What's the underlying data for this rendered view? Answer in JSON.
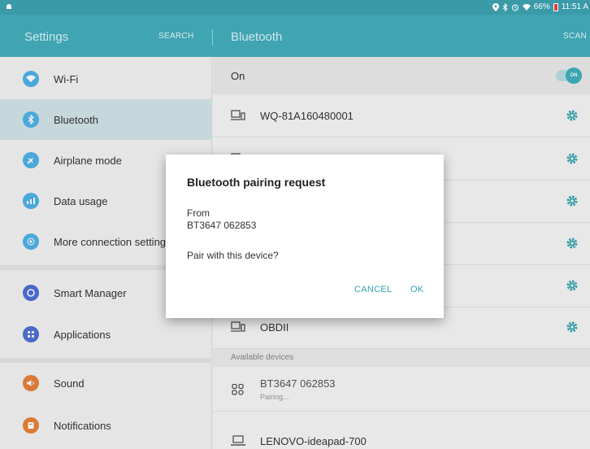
{
  "status_bar": {
    "battery": "66%",
    "time": "11:51 A"
  },
  "app_bar": {
    "left_title": "Settings",
    "search_label": "SEARCH",
    "right_title": "Bluetooth",
    "scan_label": "SCAN"
  },
  "sidebar": {
    "items": [
      {
        "label": "Wi-Fi",
        "icon": "wifi-icon",
        "color": "#4fb3e8"
      },
      {
        "label": "Bluetooth",
        "icon": "bluetooth-icon",
        "color": "#4fb3e8"
      },
      {
        "label": "Airplane mode",
        "icon": "airplane-icon",
        "color": "#4fb3e8"
      },
      {
        "label": "Data usage",
        "icon": "data-usage-icon",
        "color": "#4fb3e8"
      },
      {
        "label": "More connection settings",
        "icon": "more-connection-icon",
        "color": "#4fb3e8"
      },
      {
        "label": "Smart Manager",
        "icon": "smart-manager-icon",
        "color": "#4f6fd6"
      },
      {
        "label": "Applications",
        "icon": "applications-icon",
        "color": "#4f6fd6"
      },
      {
        "label": "Sound",
        "icon": "sound-icon",
        "color": "#e8823a"
      },
      {
        "label": "Notifications",
        "icon": "notifications-icon",
        "color": "#e8823a"
      }
    ]
  },
  "bluetooth": {
    "on_label": "On",
    "toggle_label": "ON",
    "paired_devices": [
      {
        "name": "WQ-81A160480001"
      },
      {
        "name": ""
      },
      {
        "name": ""
      },
      {
        "name": ""
      },
      {
        "name": ""
      },
      {
        "name": "OBDII"
      }
    ],
    "available_header": "Available devices",
    "available_devices": [
      {
        "name": "BT3647  062853",
        "status": "Pairing..."
      },
      {
        "name": "LENOVO-ideapad-700",
        "status": ""
      }
    ]
  },
  "dialog": {
    "title": "Bluetooth pairing request",
    "from_label": "From",
    "device": "BT3647  062853",
    "message": "Pair with this device?",
    "cancel_label": "CANCEL",
    "ok_label": "OK"
  },
  "colors": {
    "accent": "#40a4b2",
    "status_bar": "#3a9aa8",
    "selected_row": "#d3e6ea",
    "dialog_button": "#2fa3b2"
  }
}
